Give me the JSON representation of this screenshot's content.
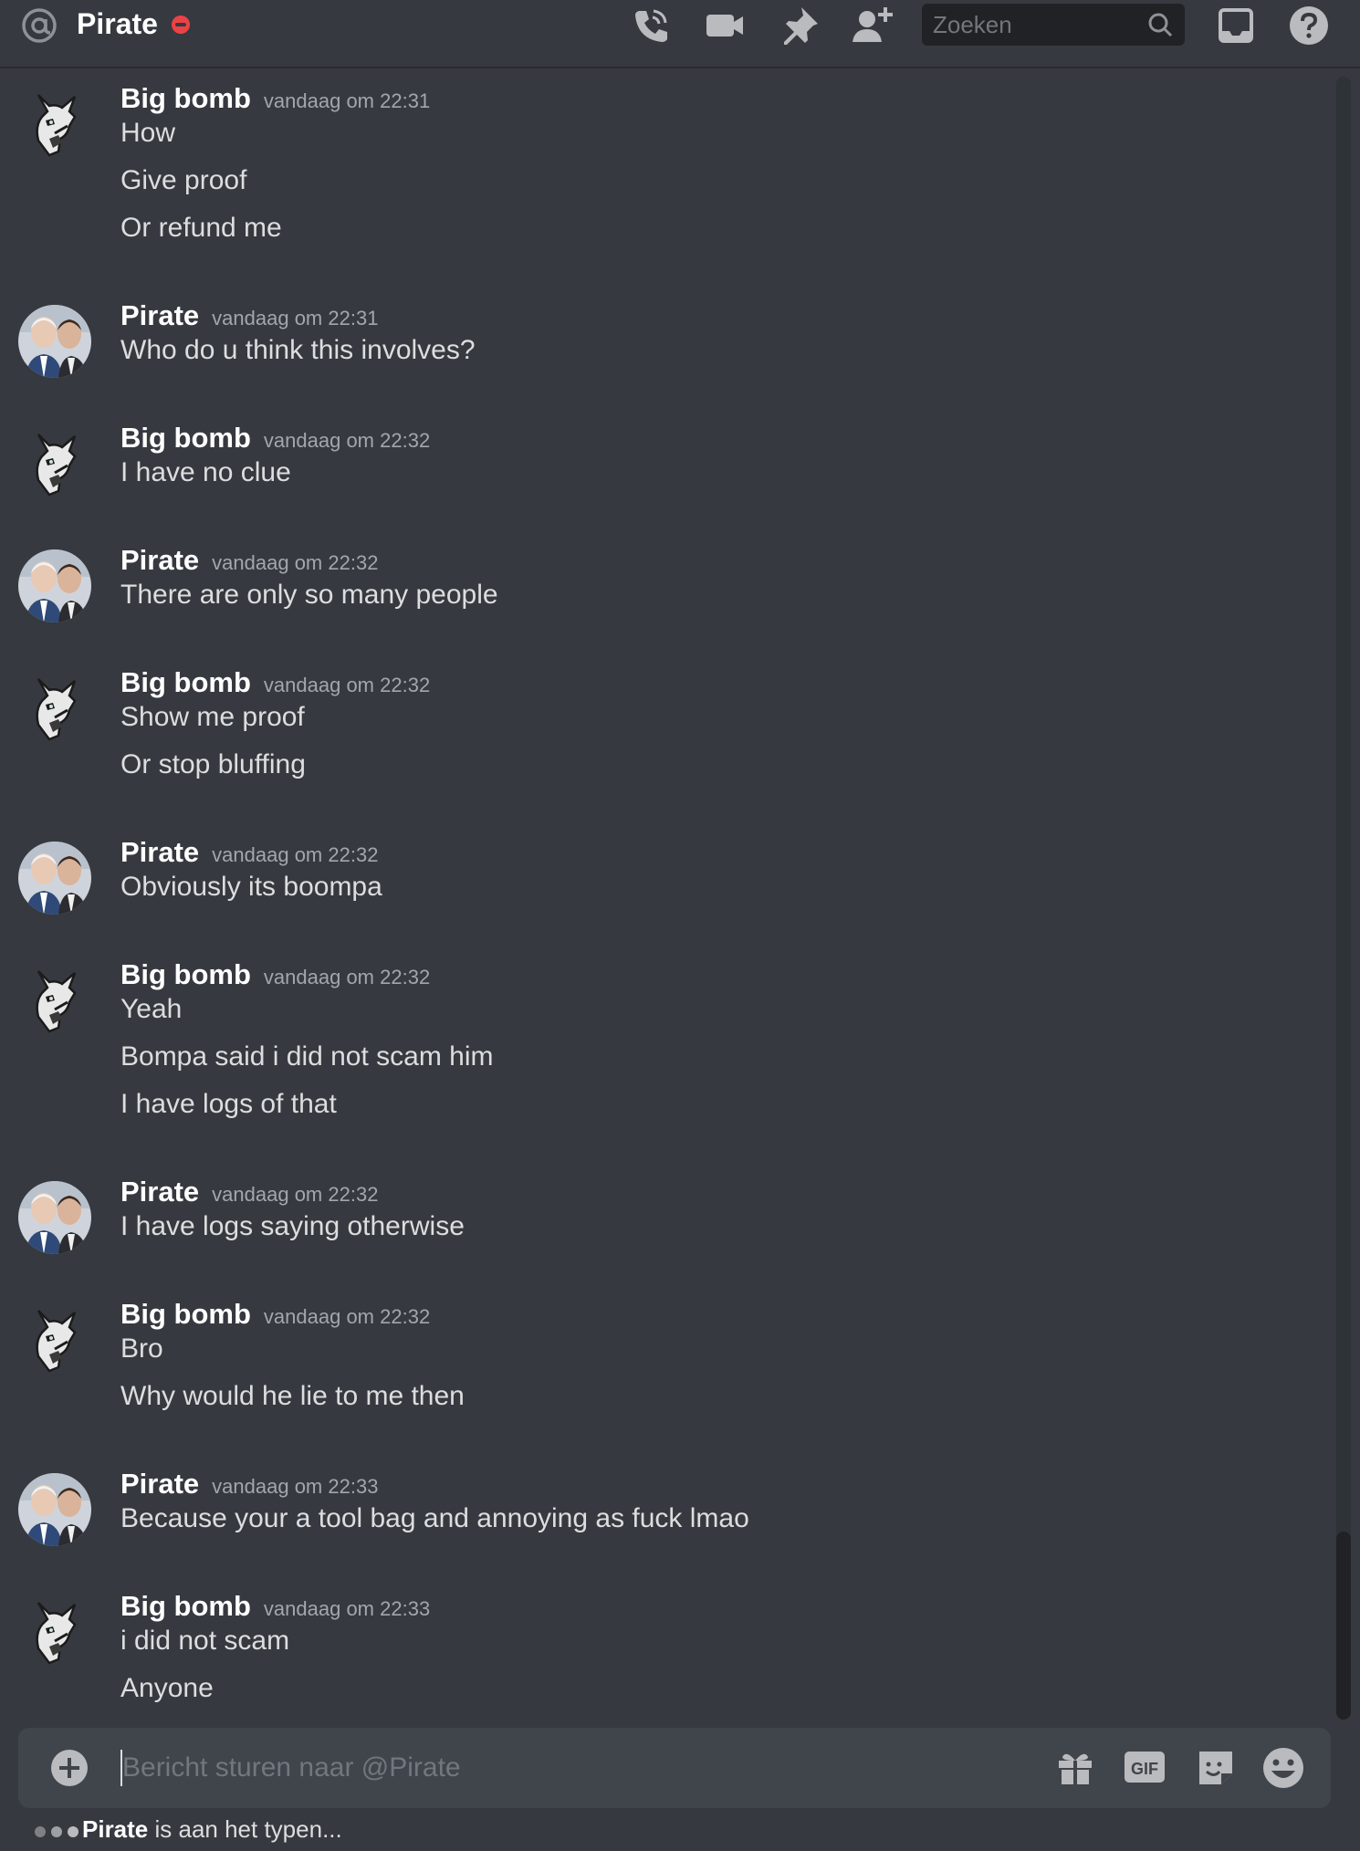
{
  "header": {
    "channel_name": "Pirate",
    "status": "dnd",
    "icons": [
      "at-icon",
      "phone-icon",
      "video-icon",
      "pin-icon",
      "add-member-icon",
      "search-icon",
      "inbox-icon",
      "help-icon"
    ],
    "search_placeholder": "Zoeken"
  },
  "messages": [
    {
      "author": "Big bomb",
      "time": "vandaag om 22:31",
      "lines": [
        "How",
        "Give proof",
        "Or refund me"
      ]
    },
    {
      "author": "Pirate",
      "time": "vandaag om 22:31",
      "lines": [
        "Who do u think this involves?"
      ]
    },
    {
      "author": "Big bomb",
      "time": "vandaag om 22:32",
      "lines": [
        "I have no clue"
      ]
    },
    {
      "author": "Pirate",
      "time": "vandaag om 22:32",
      "lines": [
        "There are only so many people"
      ]
    },
    {
      "author": "Big bomb",
      "time": "vandaag om 22:32",
      "lines": [
        "Show me proof",
        "Or stop bluffing"
      ]
    },
    {
      "author": "Pirate",
      "time": "vandaag om 22:32",
      "lines": [
        "Obviously its boompa"
      ]
    },
    {
      "author": "Big bomb",
      "time": "vandaag om 22:32",
      "lines": [
        "Yeah",
        "Bompa said i did not scam him",
        "I have logs of that"
      ]
    },
    {
      "author": "Pirate",
      "time": "vandaag om 22:32",
      "lines": [
        "I have logs saying otherwise"
      ]
    },
    {
      "author": "Big bomb",
      "time": "vandaag om 22:32",
      "lines": [
        "Bro",
        "Why would he lie to me then"
      ]
    },
    {
      "author": "Pirate",
      "time": "vandaag om 22:33",
      "lines": [
        "Because your a tool bag and annoying as fuck lmao"
      ]
    },
    {
      "author": "Big bomb",
      "time": "vandaag om 22:33",
      "lines": [
        "i did not scam",
        "Anyone"
      ]
    }
  ],
  "composer": {
    "placeholder": "Bericht sturen naar @Pirate",
    "gif_label": "GIF",
    "icons": [
      "add-attachment-icon",
      "gift-icon",
      "gif-icon",
      "sticker-icon",
      "emoji-icon"
    ]
  },
  "typing": {
    "user": "Pirate",
    "text": " is aan het typen..."
  },
  "colors": {
    "background": "#36393f",
    "composer": "#40444b",
    "search": "#202225",
    "dnd": "#ed4245",
    "text": "#dcddde",
    "muted": "#a3a6aa"
  }
}
